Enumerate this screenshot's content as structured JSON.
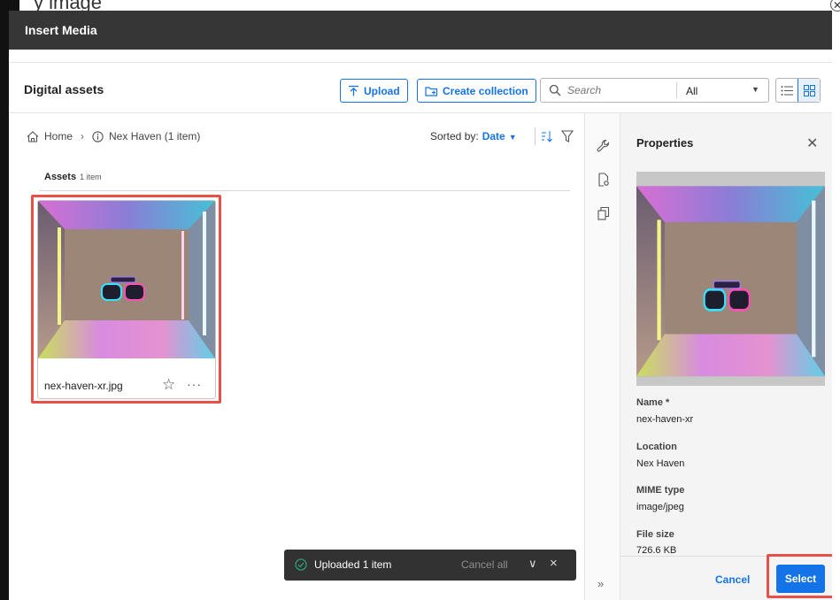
{
  "page_title": "Insert Media",
  "toolbar": {
    "title": "Digital assets",
    "upload_label": "Upload",
    "create_collection_label": "Create collection",
    "search_placeholder": "Search",
    "search_scope": "All"
  },
  "breadcrumb": {
    "home": "Home",
    "current": "Nex Haven (1 item)"
  },
  "sort": {
    "label": "Sorted by:",
    "value": "Date"
  },
  "assets_section": {
    "title": "Assets",
    "count": "1 item"
  },
  "asset": {
    "filename": "nex-haven-xr.jpg",
    "more_label": "···"
  },
  "properties": {
    "title": "Properties",
    "name_label": "Name *",
    "name_value": "nex-haven-xr",
    "location_label": "Location",
    "location_value": "Nex Haven",
    "mime_label": "MIME type",
    "mime_value": "image/jpeg",
    "size_label": "File size",
    "size_value": "726.6 KB",
    "cancel_label": "Cancel",
    "select_label": "Select"
  },
  "toast": {
    "message": "Uploaded 1 item",
    "cancel_all": "Cancel all"
  },
  "background_text": "y image",
  "colors": {
    "accent": "#1473e6",
    "header_bg": "#363636",
    "highlight": "#e8514a",
    "toast_bg": "#323232",
    "success": "#2d9d78"
  },
  "icons": {
    "upload": "upload-icon",
    "collection": "create-collection-icon",
    "search": "search-icon",
    "list_view": "list-view-icon",
    "grid_view": "grid-view-icon",
    "home": "home-icon",
    "info": "info-icon",
    "sort": "sort-order-icon",
    "filter": "filter-icon",
    "star": "star-icon",
    "wrench": "wrench-icon",
    "file_preview": "file-preview-icon",
    "copy": "copy-icon",
    "expand": "double-chevron-right-icon",
    "check": "check-circle-icon",
    "chevron": "chevron-down-icon",
    "close": "close-icon"
  }
}
